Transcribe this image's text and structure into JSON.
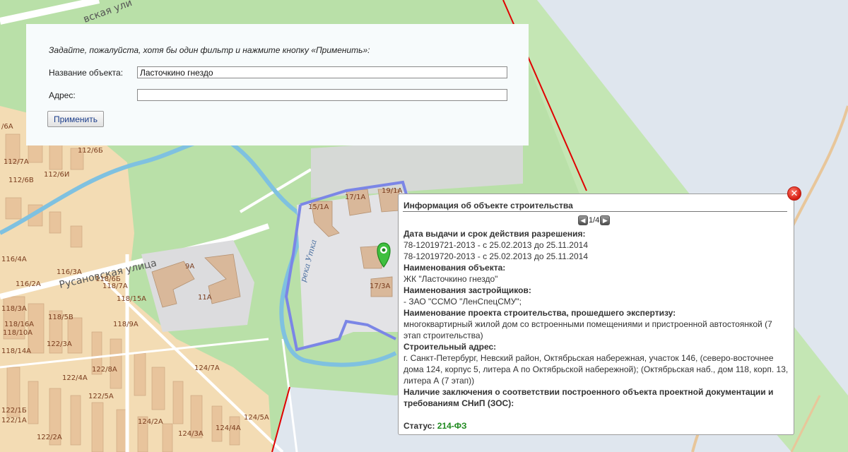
{
  "map": {
    "streets": {
      "rusanovskaya": "Русановская улица",
      "top_street": "вская ули"
    },
    "river": "река Утка",
    "building_labels": [
      "112/7А",
      "112/6Б",
      "112/6В",
      "112/6И",
      "/6А",
      "116/4А",
      "116/3А",
      "116/2А",
      "118/3А",
      "118/5В",
      "118/16А",
      "118/10А",
      "118/14А",
      "118/7А",
      "118/15А",
      "118/9А",
      "118/6Б",
      "122/3А",
      "122/4А",
      "122/8А",
      "122/5А",
      "122/1Б",
      "122/1А",
      "122/2А",
      "124/2А",
      "124/3А",
      "124/4А",
      "124/5А",
      "124/7А",
      "9А",
      "11А",
      "15/1А",
      "17/1А",
      "19/1А",
      "17/3А"
    ],
    "colors": {
      "land": "#dfe6ee",
      "park": "#b9e0a8",
      "residential": "#f3dcb4",
      "building": "#d9b89a",
      "site_outline": "#7b86e6",
      "boundary": "#e00000"
    }
  },
  "filter": {
    "hint": "Задайте, пожалуйста, хотя бы один фильтр и нажмите кнопку «Применить»:",
    "name_label": "Название объекта:",
    "name_value": "Ласточкино гнездо",
    "address_label": "Адрес:",
    "address_value": "",
    "apply_label": "Применить"
  },
  "popup": {
    "title": "Информация об объекте строительства",
    "pager": {
      "prev_icon": "arrow-left-icon",
      "count": "1/4",
      "next_icon": "arrow-right-icon"
    },
    "sections": [
      {
        "heading": "Дата выдачи и срок действия разрешения:",
        "lines": [
          "78-12019721-2013 - с 25.02.2013 до 25.11.2014",
          "78-12019720-2013 - с 25.02.2013 до 25.11.2014"
        ]
      },
      {
        "heading": "Наименования объекта:",
        "lines": [
          "ЖК \"Ласточкино гнездо\""
        ]
      },
      {
        "heading": "Наименования застройщиков:",
        "lines": [
          "- ЗАО \"ССМО \"ЛенСпецСМУ\";"
        ]
      },
      {
        "heading": "Наименование проекта строительства, прошедшего экспертизу:",
        "lines": [
          "многоквартирный жилой дом со встроенными помещениями и пристроенной автостоянкой (7 этап строительства)"
        ]
      },
      {
        "heading": "Строительный адрес:",
        "lines": [
          "г. Санкт-Петербург, Невский район, Октябрьская набережная, участок 146, (северо-восточнее дома 124, корпус 5, литера А по Октябрьской набережной); (Октябрьская наб., дом 118, корп. 13, литера А (7 этап))"
        ]
      },
      {
        "heading": "Наличие заключения о соответствии построенного объекта проектной документации и требованиям СНиП (ЗОС):",
        "lines": []
      }
    ],
    "status_label": "Статус:",
    "status_value": "214-ФЗ",
    "close_icon": "close-icon"
  }
}
